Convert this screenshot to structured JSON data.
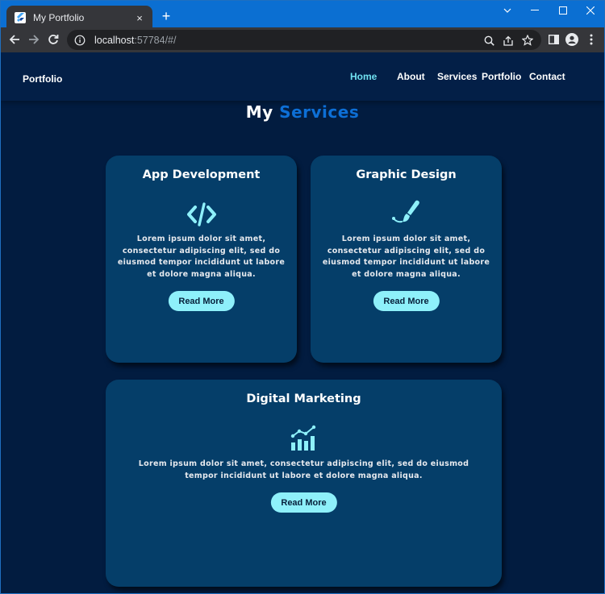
{
  "browser": {
    "tab_title": "My Portfolio",
    "url_host": "localhost",
    "url_rest": ":57784/#/",
    "new_tab_symbol": "+",
    "close_tab_symbol": "×"
  },
  "nav": {
    "brand": "Portfolio",
    "links": [
      "Home",
      "About",
      "Services",
      "Portfolio",
      "Contact"
    ],
    "active_link": "Home",
    "active_color": "#6fe0f0"
  },
  "services": {
    "title_part1": "My",
    "title_part2": "Services",
    "accent_color": "#0d6fd6",
    "cards": [
      {
        "title": "App Development",
        "icon": "code-icon",
        "text": "Lorem ipsum dolor sit amet, consectetur adipiscing elit, sed do eiusmod tempor incididunt ut labore et dolore magna aliqua.",
        "button": "Read More"
      },
      {
        "title": "Graphic Design",
        "icon": "paintbrush-icon",
        "text": "Lorem ipsum dolor sit amet, consectetur adipiscing elit, sed do eiusmod tempor incididunt ut labore et dolore magna aliqua.",
        "button": "Read More"
      },
      {
        "title": "Digital Marketing",
        "icon": "growth-chart-icon",
        "text": "Lorem ipsum dolor sit amet, consectetur adipiscing elit, sed do eiusmod tempor incididunt ut labore et dolore magna aliqua.",
        "button": "Read More"
      }
    ]
  },
  "colors": {
    "page_bg": "#021c40",
    "card_bg": "#053e69",
    "button_bg": "#8ef0fa",
    "icon_color": "#8ef0fa"
  }
}
